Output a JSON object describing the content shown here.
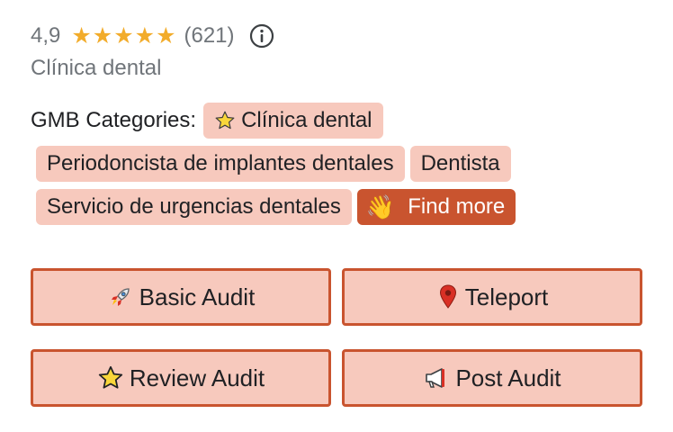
{
  "rating": {
    "value": "4,9",
    "stars": 5,
    "count": "(621)",
    "star_color": "#f2ac2b"
  },
  "subtitle": "Clínica dental",
  "categories": {
    "label": "GMB Categories:",
    "primary": "Clínica dental",
    "items": [
      "Periodoncista de implantes dentales",
      "Dentista",
      "Servicio de urgencias dentales"
    ],
    "more_label": "Find more"
  },
  "buttons": {
    "basic": "Basic Audit",
    "teleport": "Teleport",
    "review": "Review Audit",
    "post": "Post Audit"
  },
  "colors": {
    "chip_bg": "#f7c9bd",
    "accent": "#c9542f",
    "muted_text": "#70757a"
  },
  "icons": {
    "primary_category": "star-icon",
    "more": "waving-hand-icon",
    "basic": "rocket-icon",
    "teleport": "map-pin-icon",
    "review": "star-icon",
    "post": "megaphone-icon",
    "info": "info-icon"
  }
}
